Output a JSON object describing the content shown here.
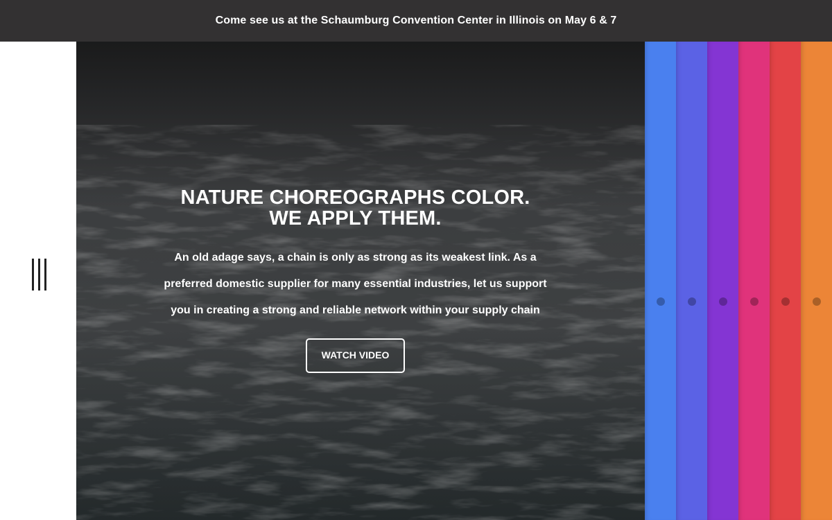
{
  "announcement": {
    "text": "Come see us at the Schaumburg Convention Center in Illinois on May 6 & 7"
  },
  "menu": {
    "icon": "menu-bars-icon"
  },
  "hero": {
    "title_line1": "NATURE CHOREOGRAPHS COLOR.",
    "title_line2": "WE APPLY THEM.",
    "body": "An old adage says, a chain is only as strong as its weakest link. As a preferred domestic supplier for many essential industries, let us support you in creating a strong and reliable network within your supply chain",
    "cta_label": "WATCH VIDEO",
    "background": "dark ocean waves photograph"
  },
  "color_panels": [
    {
      "color": "#4a80ef"
    },
    {
      "color": "#5b62e5"
    },
    {
      "color": "#8435d3"
    },
    {
      "color": "#e0337b"
    },
    {
      "color": "#e34346"
    },
    {
      "color": "#ec8537"
    }
  ],
  "colors": {
    "announcement_bg": "#333132",
    "text_on_dark": "#ffffff"
  }
}
